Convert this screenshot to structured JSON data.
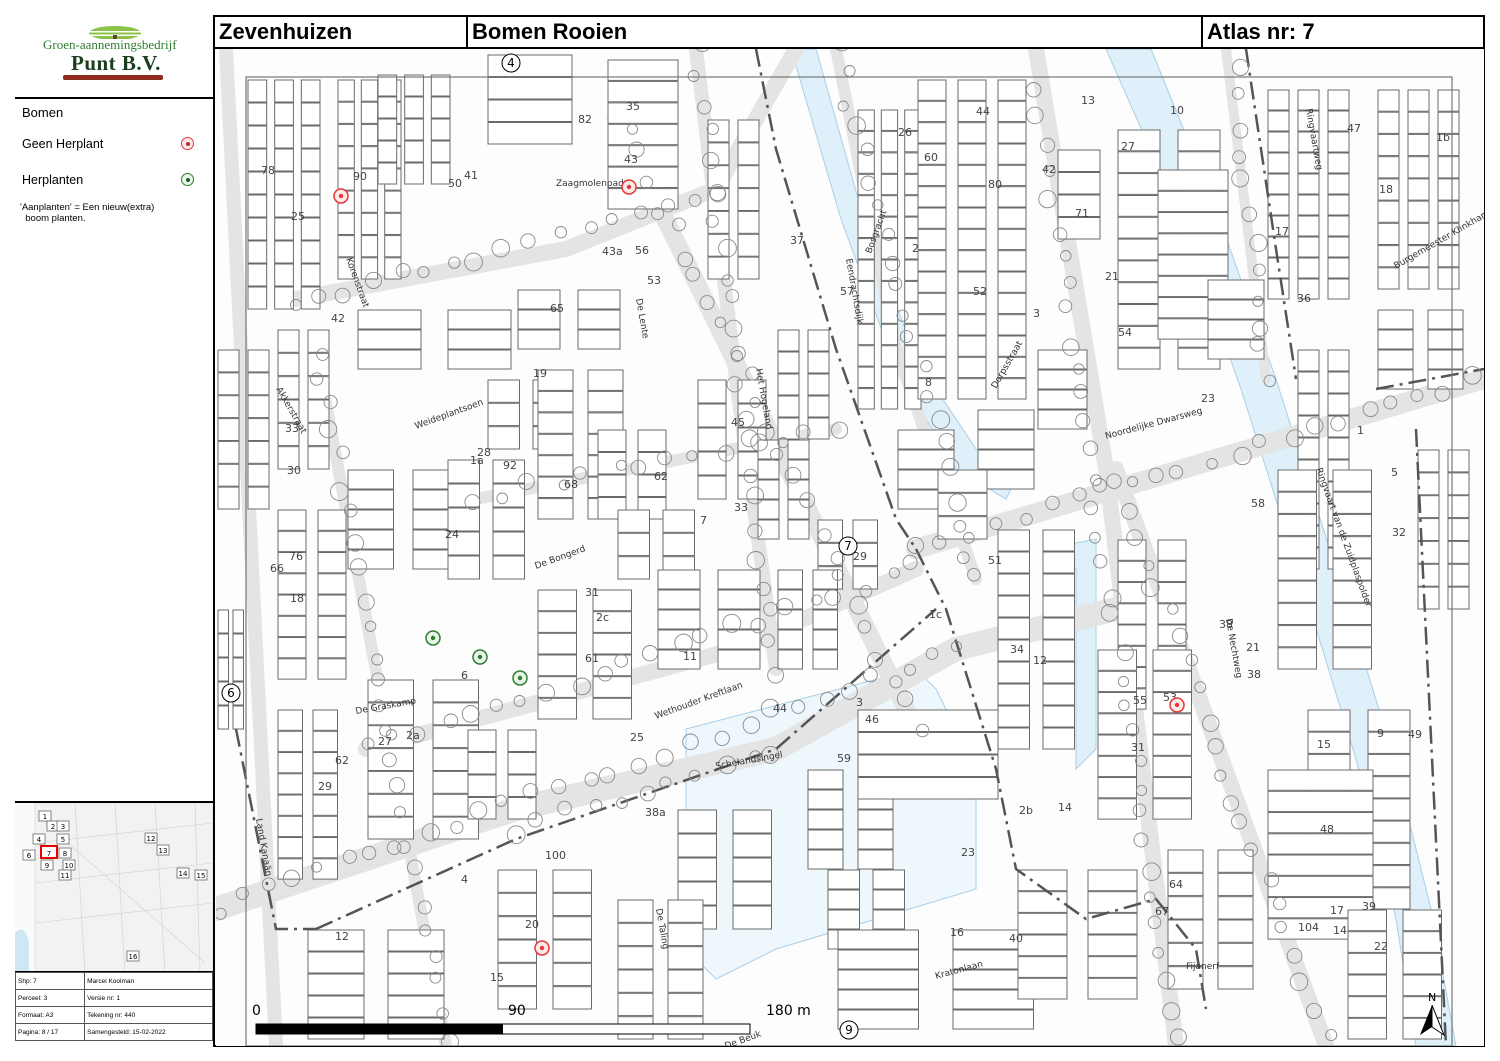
{
  "header": {
    "place": "Zevenhuizen",
    "subject": "Bomen Rooien",
    "atlas": "Atlas nr: 7"
  },
  "logo": {
    "line1": "Groen-aannemingsbedrijf",
    "line2": "Punt B.V."
  },
  "legend": {
    "title": "Bomen",
    "items": [
      {
        "label": "Geen Herplant",
        "symbol": "red-tree-icon",
        "color": "#e53935"
      },
      {
        "label": "Herplanten",
        "symbol": "green-tree-icon",
        "color": "#2e7d32"
      }
    ],
    "note": "'Aanplanten' = Een nieuw(extra)\n  boom planten."
  },
  "metadata": {
    "rows": [
      [
        "Shp: 7",
        "Marcel Kooiman"
      ],
      [
        "Perceel: 3",
        "Versie nr: 1"
      ],
      [
        "Formaat: A3",
        "Tekening nr: 440"
      ],
      [
        "Pagina: 8 / 17",
        "Samengesteld: 15-02-2022"
      ]
    ]
  },
  "overview": {
    "tiles": [
      "1",
      "2",
      "3",
      "4",
      "5",
      "6",
      "7",
      "8",
      "9",
      "10",
      "11",
      "12",
      "13",
      "14",
      "15",
      "16"
    ],
    "current": "7"
  },
  "map": {
    "adjacent_sheets": {
      "top": "4",
      "left": "6",
      "bottom": "9",
      "center": "7"
    },
    "streets": [
      "Zaagmolenpad",
      "Korenstraat",
      "De Lente",
      "Het Hogeland",
      "Eendrachtsdijk",
      "Bosgracht",
      "Dorpsstraat",
      "Noordelijke Dwarsweg",
      "Ringvaart van de Zuidplaspolder",
      "Burgemeester Klinkhamerweg",
      "Ringvaartweg",
      "Akkerstraat",
      "Weideplantsoen",
      "De Bongerd",
      "De Graskamp",
      "Wethouder Kreftlaan",
      "Schelandsingel",
      "Land Kanaän",
      "De Beuk",
      "De Taling",
      "Kratonlaan",
      "Fijanerf",
      "De Nechtweg"
    ],
    "house_numbers": [
      "53",
      "1",
      "3",
      "5",
      "7",
      "9",
      "11",
      "13",
      "15",
      "17",
      "19",
      "21",
      "23",
      "25",
      "27",
      "29",
      "31",
      "33",
      "35",
      "37",
      "39",
      "2",
      "4",
      "6",
      "8",
      "10",
      "12",
      "14",
      "16",
      "18",
      "20",
      "22",
      "24",
      "26",
      "28",
      "30",
      "32",
      "34",
      "36",
      "38",
      "40",
      "42",
      "44",
      "46",
      "48",
      "50",
      "52",
      "54",
      "56",
      "100",
      "104",
      "65",
      "67",
      "71",
      "61",
      "59",
      "57",
      "55",
      "53",
      "51",
      "49",
      "47",
      "45",
      "43",
      "43a",
      "41",
      "90",
      "92",
      "82",
      "80",
      "78",
      "76",
      "68",
      "66",
      "64",
      "62",
      "60",
      "58",
      "1a",
      "1b",
      "1c",
      "2a",
      "2b",
      "2c",
      "3",
      "38",
      "38a",
      "12",
      "14",
      "18",
      "17",
      "15",
      "21",
      "23",
      "25",
      "27",
      "29",
      "31",
      "33",
      "44",
      "42",
      "62"
    ],
    "removal_trees": [
      {
        "status": "Geen Herplant",
        "location": "Korenstraat"
      },
      {
        "status": "Geen Herplant",
        "location": "Zaagmolenpad"
      },
      {
        "status": "Geen Herplant",
        "location": "Dorpsstraat"
      },
      {
        "status": "Geen Herplant",
        "location": "Wethouder Kreftlaan"
      },
      {
        "status": "Herplanten",
        "location": "De Graskamp"
      },
      {
        "status": "Herplanten",
        "location": "De Graskamp"
      },
      {
        "status": "Herplanten",
        "location": "De Graskamp"
      }
    ],
    "scalebar": {
      "labels": [
        "0",
        "90",
        "180 m"
      ]
    },
    "north_label": "N"
  },
  "colors": {
    "water": "#dff0fa",
    "road": "#e6e6e6",
    "building_stroke": "#6b6b6b",
    "border_line": "#555555"
  }
}
